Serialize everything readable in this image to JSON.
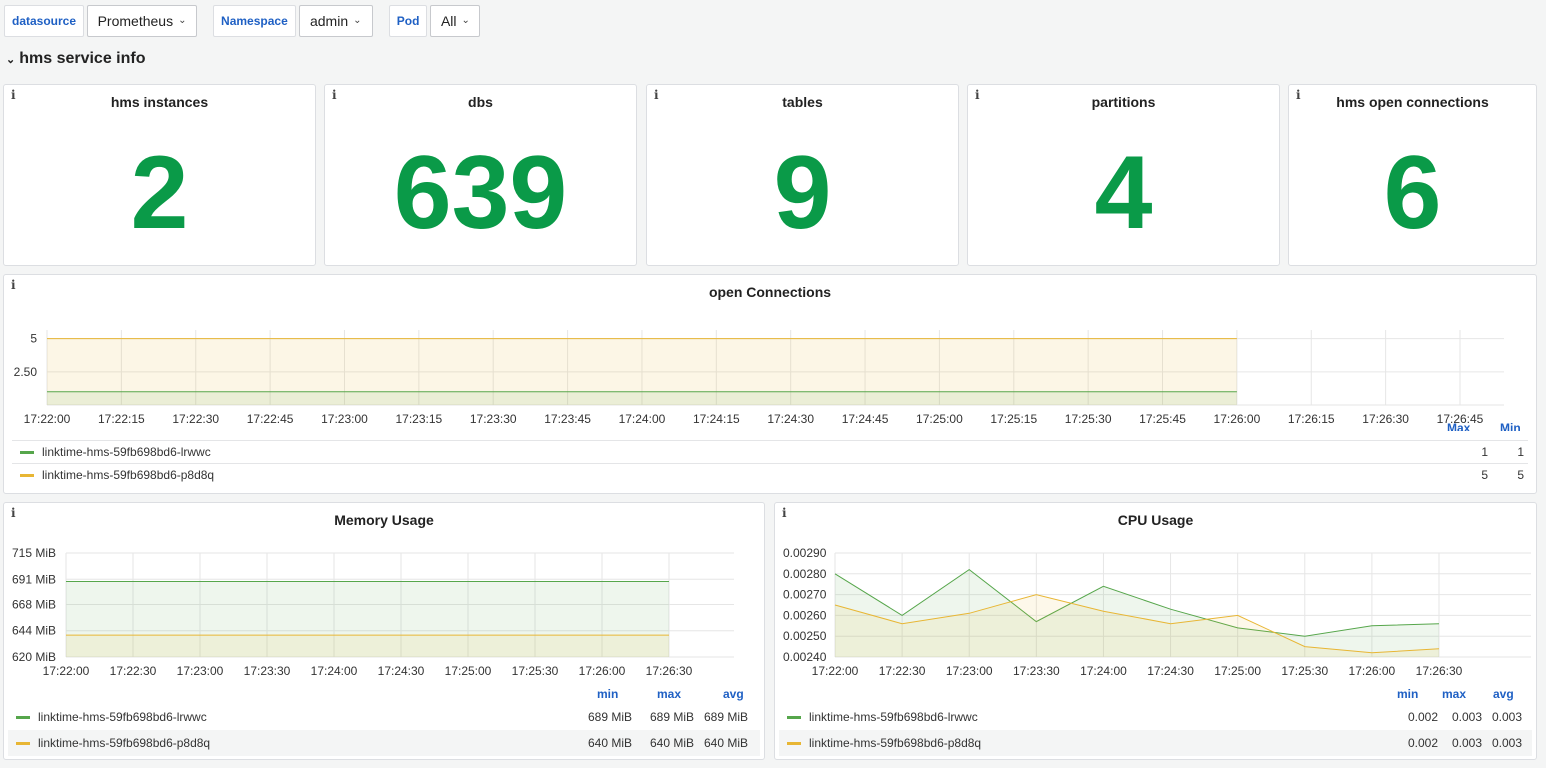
{
  "variables": [
    {
      "label": "datasource",
      "value": "Prometheus"
    },
    {
      "label": "Namespace",
      "value": "admin"
    },
    {
      "label": "Pod",
      "value": "All"
    }
  ],
  "row": {
    "title": "hms service info"
  },
  "stats": [
    {
      "title": "hms instances",
      "value": "2"
    },
    {
      "title": "dbs",
      "value": "639"
    },
    {
      "title": "tables",
      "value": "9"
    },
    {
      "title": "partitions",
      "value": "4"
    },
    {
      "title": "hms open connections",
      "value": "6"
    }
  ],
  "info_icon": "i",
  "colors": {
    "green": "#0a9a48",
    "series_green": "#56a64b",
    "series_yellow": "#e8b634",
    "link_blue": "#1f60c4"
  },
  "open_connections": {
    "title": "open Connections",
    "y_ticks": [
      "5",
      "2.50"
    ],
    "x_ticks": [
      "17:22:00",
      "17:22:15",
      "17:22:30",
      "17:22:45",
      "17:23:00",
      "17:23:15",
      "17:23:30",
      "17:23:45",
      "17:24:00",
      "17:24:15",
      "17:24:30",
      "17:24:45",
      "17:25:00",
      "17:25:15",
      "17:25:30",
      "17:25:45",
      "17:26:00",
      "17:26:15",
      "17:26:30",
      "17:26:45"
    ],
    "legend_headers": {
      "max": "Max",
      "min": "Min"
    },
    "series": [
      {
        "name": "linktime-hms-59fb698bd6-lrwwc",
        "max": "1",
        "min": "1",
        "value": 1
      },
      {
        "name": "linktime-hms-59fb698bd6-p8d8q",
        "max": "5",
        "min": "5",
        "value": 5
      }
    ],
    "ylim": [
      0,
      5.5
    ]
  },
  "memory": {
    "title": "Memory Usage",
    "y_ticks": [
      "715 MiB",
      "691 MiB",
      "668 MiB",
      "644 MiB",
      "620 MiB"
    ],
    "x_ticks": [
      "17:22:00",
      "17:22:30",
      "17:23:00",
      "17:23:30",
      "17:24:00",
      "17:24:30",
      "17:25:00",
      "17:25:30",
      "17:26:00",
      "17:26:30"
    ],
    "legend_headers": {
      "min": "min",
      "max": "max",
      "avg": "avg"
    },
    "series": [
      {
        "name": "linktime-hms-59fb698bd6-lrwwc",
        "min": "689 MiB",
        "max": "689 MiB",
        "avg": "689 MiB",
        "value": 689
      },
      {
        "name": "linktime-hms-59fb698bd6-p8d8q",
        "min": "640 MiB",
        "max": "640 MiB",
        "avg": "640 MiB",
        "value": 640
      }
    ],
    "ylim": [
      620,
      715
    ]
  },
  "cpu": {
    "title": "CPU Usage",
    "y_ticks": [
      "0.00290",
      "0.00280",
      "0.00270",
      "0.00260",
      "0.00250",
      "0.00240"
    ],
    "x_ticks": [
      "17:22:00",
      "17:22:30",
      "17:23:00",
      "17:23:30",
      "17:24:00",
      "17:24:30",
      "17:25:00",
      "17:25:30",
      "17:26:00",
      "17:26:30"
    ],
    "legend_headers": {
      "min": "min",
      "max": "max",
      "avg": "avg"
    },
    "series": [
      {
        "name": "linktime-hms-59fb698bd6-lrwwc",
        "min": "0.002",
        "max": "0.003",
        "avg": "0.003",
        "values": [
          0.0028,
          0.0026,
          0.00282,
          0.00257,
          0.00274,
          0.00263,
          0.00254,
          0.0025,
          0.00255,
          0.00256
        ]
      },
      {
        "name": "linktime-hms-59fb698bd6-p8d8q",
        "min": "0.002",
        "max": "0.003",
        "avg": "0.003",
        "values": [
          0.00265,
          0.00256,
          0.00261,
          0.0027,
          0.00262,
          0.00256,
          0.0026,
          0.00245,
          0.00242,
          0.00244
        ]
      }
    ],
    "ylim": [
      0.0024,
      0.0029
    ]
  },
  "chart_data": [
    {
      "type": "area",
      "title": "open Connections",
      "x": [
        "17:22:00",
        "17:26:00"
      ],
      "series": [
        {
          "name": "linktime-hms-59fb698bd6-lrwwc",
          "values": [
            1,
            1
          ]
        },
        {
          "name": "linktime-hms-59fb698bd6-p8d8q",
          "values": [
            5,
            5
          ]
        }
      ],
      "ylim": [
        0,
        5.5
      ],
      "grid": true,
      "legend": "bottom"
    },
    {
      "type": "area",
      "title": "Memory Usage",
      "x": [
        "17:22:00",
        "17:26:30"
      ],
      "series": [
        {
          "name": "linktime-hms-59fb698bd6-lrwwc",
          "values": [
            689,
            689
          ]
        },
        {
          "name": "linktime-hms-59fb698bd6-p8d8q",
          "values": [
            640,
            640
          ]
        }
      ],
      "ylim": [
        620,
        715
      ],
      "grid": true,
      "legend": "bottom"
    },
    {
      "type": "line",
      "title": "CPU Usage",
      "x": [
        "17:22:00",
        "17:22:30",
        "17:23:00",
        "17:23:30",
        "17:24:00",
        "17:24:30",
        "17:25:00",
        "17:25:30",
        "17:26:00",
        "17:26:30"
      ],
      "series": [
        {
          "name": "linktime-hms-59fb698bd6-lrwwc",
          "values": [
            0.0028,
            0.0026,
            0.00282,
            0.00257,
            0.00274,
            0.00263,
            0.00254,
            0.0025,
            0.00255,
            0.00256
          ]
        },
        {
          "name": "linktime-hms-59fb698bd6-p8d8q",
          "values": [
            0.00265,
            0.00256,
            0.00261,
            0.0027,
            0.00262,
            0.00256,
            0.0026,
            0.00245,
            0.00242,
            0.00244
          ]
        }
      ],
      "ylim": [
        0.0024,
        0.0029
      ],
      "grid": true,
      "legend": "bottom"
    }
  ]
}
